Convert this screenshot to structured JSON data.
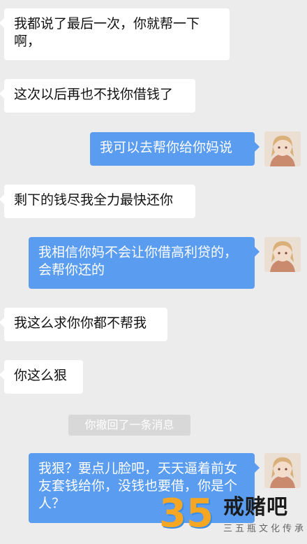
{
  "messages": [
    {
      "side": "left",
      "text": "我都说了最后一次，你就帮一下啊，"
    },
    {
      "side": "left",
      "text": "这次以后再也不找你借钱了"
    },
    {
      "side": "right",
      "text": "我可以去帮你给你妈说"
    },
    {
      "side": "left",
      "text": "剩下的钱尽我全力最快还你"
    },
    {
      "side": "right",
      "text": "我相信你妈不会让你借高利贷的，会帮你还的"
    },
    {
      "side": "left",
      "text": "我这么求你你都不帮我"
    },
    {
      "side": "left",
      "text": "你这么狠"
    },
    {
      "side": "right",
      "text": "我狠？要点儿脸吧，天天逼着前女友套钱给你，没钱也要借，你是个人？"
    }
  ],
  "system_notice": "你撤回了一条消息",
  "watermark": {
    "number": "35",
    "title": "戒赌吧",
    "subtitle": "三五瓶文化传承"
  },
  "colors": {
    "background": "#ececec",
    "right_bubble": "#5a9cf0",
    "left_bubble": "#ffffff"
  },
  "icons": [
    "avatar-anime-girl"
  ]
}
